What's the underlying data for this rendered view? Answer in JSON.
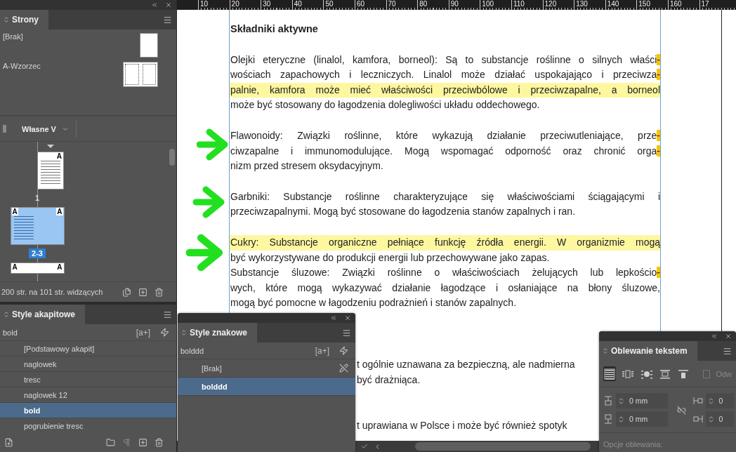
{
  "pages_panel": {
    "tab": "Strony",
    "masters": [
      {
        "name": "[Brak]",
        "kind": "single"
      },
      {
        "name": "A-Wzorzec",
        "kind": "spread"
      }
    ],
    "view_menu": "Własne V",
    "pages": [
      {
        "label": "1",
        "kind": "single",
        "masters": [
          "A"
        ],
        "selected": false
      },
      {
        "label": "2-3",
        "kind": "spread",
        "masters": [
          "A",
          "A"
        ],
        "selected": true
      },
      {
        "kind": "spread",
        "masters": [
          "A",
          "A"
        ],
        "selected": false
      }
    ],
    "status": "200 str. na 101 str. widzących"
  },
  "paragraph_styles_panel": {
    "tab": "Style akapitowe",
    "current": "bold",
    "new_style_label": "[a+]",
    "styles": [
      {
        "name": "[Podstawowy akapit]",
        "selected": false
      },
      {
        "name": "naglowek",
        "selected": false
      },
      {
        "name": "tresc",
        "selected": false
      },
      {
        "name": "naglowek 12",
        "selected": false
      },
      {
        "name": "bold",
        "selected": true
      },
      {
        "name": "pogrubienie tresc",
        "selected": false
      }
    ]
  },
  "ruler": {
    "labels": [
      "10",
      "20",
      "30",
      "40",
      "50",
      "60",
      "70",
      "80",
      "90",
      "100",
      "110",
      "120",
      "130",
      "140",
      "150",
      "160",
      "17"
    ]
  },
  "document": {
    "paragraphs": [
      {
        "kind": "heading",
        "lines": [
          {
            "text": "Składniki aktywne",
            "highlighted": false
          }
        ]
      },
      {
        "kind": "body",
        "lines": [
          {
            "text": "Olejki eteryczne (linalol, kamfora, borneol): Są to substancje roślinne o silnych właści",
            "hyphen": "-",
            "highlighted": false
          },
          {
            "text": "wościach zapachowych i leczniczych. Linalol może działać uspokajająco i przeciwza",
            "hyphen": "-",
            "highlighted": false
          },
          {
            "text": "palnie, kamfora może mieć właściwości przeciwbólowe i przeciwzapalne, a borneol",
            "highlighted": true
          },
          {
            "text": "może być stosowany do łagodzenia dolegliwości układu oddechowego.",
            "highlighted": false
          }
        ]
      },
      {
        "kind": "body",
        "lines": [
          {
            "text": "Flawonoidy: Związki roślinne, które wykazują działanie przeciwutleniające, prze",
            "hyphen": "-",
            "highlighted": false
          },
          {
            "text": "ciwzapalne i immunomodulujące. Mogą wspomagać odporność oraz chronić orga",
            "hyphen": "-",
            "highlighted": false
          },
          {
            "text": "nizm przed stresem oksydacyjnym.",
            "highlighted": false
          }
        ]
      },
      {
        "kind": "body",
        "lines": [
          {
            "text": "Garbniki: Substancje roślinne charakteryzujące się właściwościami ściągającymi i",
            "highlighted": false
          },
          {
            "text": "przeciwzapalnymi. Mogą być stosowane do łagodzenia stanów zapalnych i ran.",
            "highlighted": false
          }
        ]
      },
      {
        "kind": "body",
        "lines": [
          {
            "text": "Cukry: Substancje organiczne pełniące funkcję źródła energii. W organizmie mogą",
            "highlighted": true
          },
          {
            "text": "być wykorzystywane do produkcji energii lub przechowywane jako zapas.",
            "highlighted": false
          }
        ]
      },
      {
        "kind": "run_on",
        "lines": [
          {
            "text": "Substancje śluzowe: Związki roślinne o właściwościach żelujących lub lepkościo",
            "hyphen": "-",
            "highlighted": false
          },
          {
            "text": "wych, które mogą wykazywać działanie łagodzące i osłaniające na błony śluzowe,",
            "highlighted": false
          },
          {
            "text": "mogą być pomocne w łagodzeniu podrażnień i stanów zapalnych.",
            "highlighted": false
          }
        ]
      },
      {
        "kind": "fragment",
        "lines": [
          {
            "text": "t ogólnie uznawana za bezpieczną, ale nadmierna",
            "highlighted": false
          },
          {
            "text": "być drażniąca.",
            "highlighted": false
          }
        ]
      },
      {
        "kind": "fragment",
        "lines": [
          {
            "text": "t uprawiana w Polsce i może być również spotyk",
            "highlighted": false
          }
        ]
      }
    ]
  },
  "character_styles_panel": {
    "tab": "Style znakowe",
    "current": "bolddd",
    "new_style_label": "[a+]",
    "styles": [
      {
        "name": "[Brak]",
        "selected": false
      },
      {
        "name": "bolddd",
        "selected": true
      }
    ]
  },
  "text_wrap_panel": {
    "tab": "Oblewanie tekstem",
    "wrap_modes": [
      {
        "kind": "none",
        "selected": true
      },
      {
        "kind": "bounding_box",
        "selected": false
      },
      {
        "kind": "object_shape",
        "selected": false
      },
      {
        "kind": "jump_object",
        "selected": false
      },
      {
        "kind": "next_column",
        "selected": false
      }
    ],
    "invert": {
      "label": "Odw",
      "checked": false
    },
    "offsets": [
      {
        "kind": "top",
        "value": "0 mm"
      },
      {
        "kind": "left",
        "value": "0"
      },
      {
        "kind": "bottom",
        "value": "0 mm"
      },
      {
        "kind": "right",
        "value": "0"
      }
    ],
    "options_label": "Opcje oblewania:"
  }
}
